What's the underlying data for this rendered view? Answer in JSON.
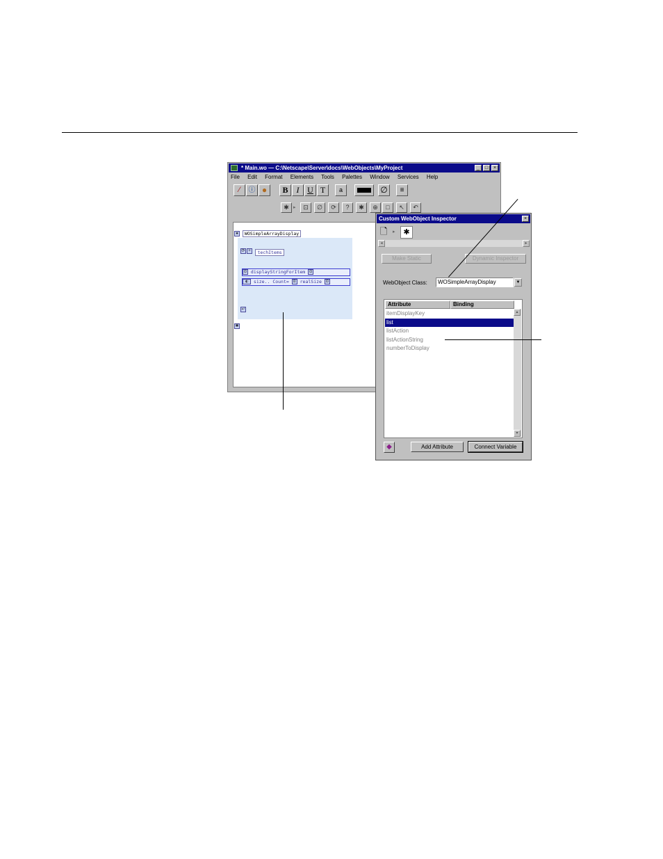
{
  "main_window": {
    "title": "* Main.wo  —  C:\\Netscape\\Server\\docs\\WebObjects\\MyProject",
    "menu": [
      "File",
      "Edit",
      "Format",
      "Elements",
      "Tools",
      "Palettes",
      "Window",
      "Services",
      "Help"
    ],
    "toolbar": {
      "bold": "B",
      "italic": "I",
      "underline": "U",
      "text": "T",
      "help": "?"
    },
    "canvas": {
      "component_name": "WOSimpleArrayDisplay",
      "repetition_binding": "techItems",
      "string_binding": "displayStringForItem",
      "condition_expr": "size.. Count=",
      "condition_binding": "realSize"
    }
  },
  "inspector": {
    "title": "Custom WebObject Inspector",
    "make_static_label": "Make Static",
    "dynamic_inspector_label": "Dynamic Inspector",
    "class_label": "WebObject Class:",
    "class_value": "WOSimpleArrayDisplay",
    "columns": [
      "Attribute",
      "Binding"
    ],
    "attributes": [
      "itemDisplayKey",
      "list",
      "listAction",
      "listActionString",
      "numberToDisplay"
    ],
    "selected_attribute": "list",
    "add_attribute_label": "Add Attribute",
    "connect_variable_label": "Connect Variable"
  }
}
